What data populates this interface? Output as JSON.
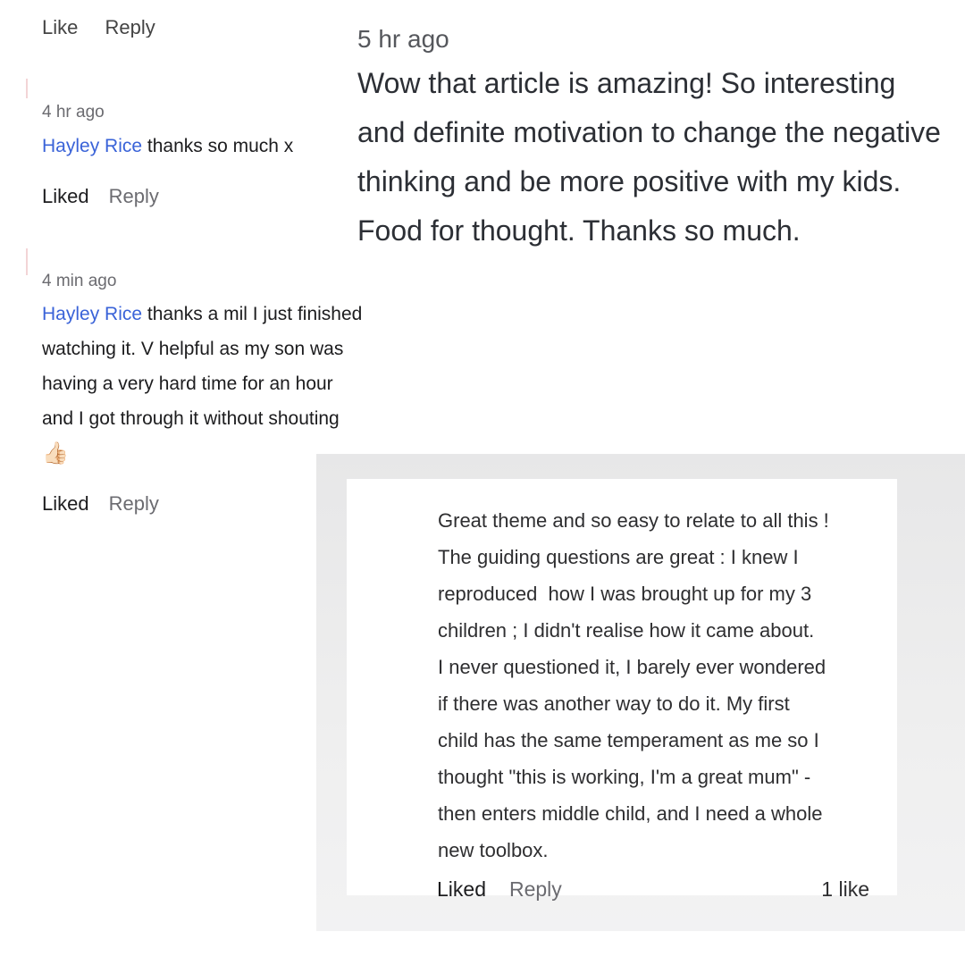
{
  "top_cropped_row": {
    "like_label": "Like",
    "reply_label": "Reply"
  },
  "comment_1": {
    "time": "4 hr ago",
    "mention": "Hayley Rice",
    "text": " thanks so much x",
    "liked_label": "Liked",
    "reply_label": "Reply"
  },
  "comment_2": {
    "time": "4 min ago",
    "mention": "Hayley Rice",
    "text_lines": [
      " thanks a mil I just finished",
      "watching it. V helpful as my son was",
      "having a very hard time for an hour",
      "and I got through it without shouting"
    ],
    "emoji": "👍🏻",
    "liked_label": "Liked",
    "reply_label": "Reply"
  },
  "right_comment": {
    "time": "5 hr ago",
    "text": "Wow that article is amazing! So interesting and definite motivation to change the negative thinking and be more positive with my kids. Food for thought. Thanks so much."
  },
  "screenshot_comment": {
    "text_lines": [
      "Great theme and so easy to relate to all this !",
      "The guiding questions are great : I knew I",
      "reproduced  how I was brought up for my 3",
      "children ; I didn't realise how it came about.",
      "I never questioned it, I barely ever wondered",
      "if there was another way to do it. My first",
      "child has the same temperament as me so I",
      "thought \"this is working, I'm a great mum\" -",
      "then enters middle child, and I need a whole",
      "new toolbox."
    ],
    "liked_label": "Liked",
    "reply_label": "Reply",
    "likes_count": "1 like"
  }
}
